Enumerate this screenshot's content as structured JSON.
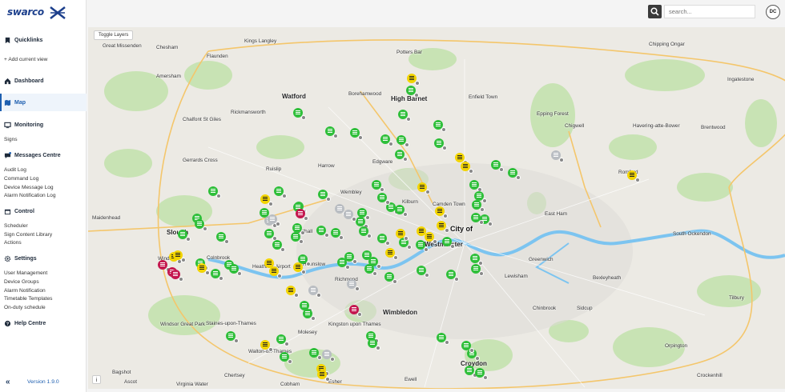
{
  "brand": {
    "name": "swarco"
  },
  "nav": {
    "quicklinks": "Quicklinks",
    "add_current_view": "+ Add current view",
    "dashboard": "Dashboard",
    "map": "Map",
    "monitoring": "Monitoring",
    "signs": "Signs",
    "messages_centre": "Messages Centre",
    "audit_log": "Audit Log",
    "command_log": "Command Log",
    "device_message_log": "Device Message Log",
    "alarm_notification_log": "Alarm Notification Log",
    "control": "Control",
    "scheduler": "Scheduler",
    "sign_content_library": "Sign Content Library",
    "actions": "Actions",
    "settings": "Settings",
    "user_management": "User Management",
    "device_groups": "Device Groups",
    "alarm_notification": "Alarm Notification",
    "timetable_templates": "Timetable Templates",
    "on_duty_schedule": "On-duty schedule",
    "help_centre": "Help Centre",
    "version": "Version 1.9.0"
  },
  "topbar": {
    "search_placeholder": "search...",
    "avatar_initials": "DC"
  },
  "map": {
    "toggle_layers": "Toggle Layers",
    "info": "i",
    "places": [
      {
        "name": "Kings Langley"
      },
      {
        "name": "Potters Bar"
      },
      {
        "name": "Chipping Ongar"
      },
      {
        "name": "Great Missenden"
      },
      {
        "name": "Chesham"
      },
      {
        "name": "Flaunden"
      },
      {
        "name": "Amersham"
      },
      {
        "name": "Watford"
      },
      {
        "name": "Borehamwood"
      },
      {
        "name": "High Barnet"
      },
      {
        "name": "Enfield Town"
      },
      {
        "name": "Epping Forest"
      },
      {
        "name": "Ingatestone"
      },
      {
        "name": "Chalfont St Giles"
      },
      {
        "name": "Rickmansworth"
      },
      {
        "name": "Chigwell"
      },
      {
        "name": "Havering-atte-Bower"
      },
      {
        "name": "Brentwood"
      },
      {
        "name": "Gerrards Cross"
      },
      {
        "name": "Ruislip"
      },
      {
        "name": "Harrow"
      },
      {
        "name": "Edgware"
      },
      {
        "name": "Romford"
      },
      {
        "name": "Wembley"
      },
      {
        "name": "Maidenhead"
      },
      {
        "name": "Slough"
      },
      {
        "name": "Southall"
      },
      {
        "name": "Kilburn"
      },
      {
        "name": "Camden Town"
      },
      {
        "name": "City of"
      },
      {
        "name": "Westminster"
      },
      {
        "name": "East Ham"
      },
      {
        "name": "South Ockendon"
      },
      {
        "name": "Windsor"
      },
      {
        "name": "Colnbrook"
      },
      {
        "name": "Heathrow Airport"
      },
      {
        "name": "Hounslow"
      },
      {
        "name": "Richmond"
      },
      {
        "name": "Lewisham"
      },
      {
        "name": "Greenwich"
      },
      {
        "name": "Bexleyheath"
      },
      {
        "name": "Tilbury"
      },
      {
        "name": "Windsor Great Park"
      },
      {
        "name": "Staines-upon-Thames"
      },
      {
        "name": "Wimbledon"
      },
      {
        "name": "Chinbrook"
      },
      {
        "name": "Sidcup"
      },
      {
        "name": "Kingston upon Thames"
      },
      {
        "name": "Molesey"
      },
      {
        "name": "Walton-on-Thames"
      },
      {
        "name": "Orpington"
      },
      {
        "name": "Croydon"
      },
      {
        "name": "Bagshot"
      },
      {
        "name": "Ewell"
      },
      {
        "name": "Chertsey"
      },
      {
        "name": "Crockenhill"
      },
      {
        "name": "Ascot"
      },
      {
        "name": "Virginia Water"
      },
      {
        "name": "Cobham"
      },
      {
        "name": "Esher"
      }
    ],
    "marker_counts": {
      "green": 72,
      "yellow": 22,
      "grey": 8,
      "red": 5
    }
  },
  "colors": {
    "accent": "#1e5fb0",
    "green_marker": "#2fbf3a",
    "yellow_marker": "#f2d400",
    "red_marker": "#c4184f",
    "grey_marker": "#b9bdc2",
    "thames": "#7cc4f0"
  }
}
